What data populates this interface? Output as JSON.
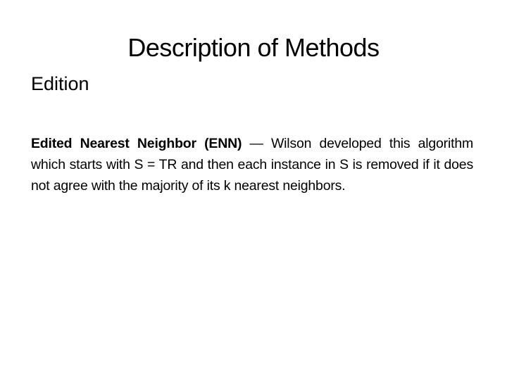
{
  "slide": {
    "title": "Description of Methods",
    "subtitle": "Edition",
    "paragraph": {
      "term": "Edited Nearest Neighbor (ENN)",
      "separator": " — ",
      "text": "Wilson developed this algorithm which starts with S = TR and then each instance in S is removed if it does not agree with the majority of its k nearest neighbors."
    }
  }
}
